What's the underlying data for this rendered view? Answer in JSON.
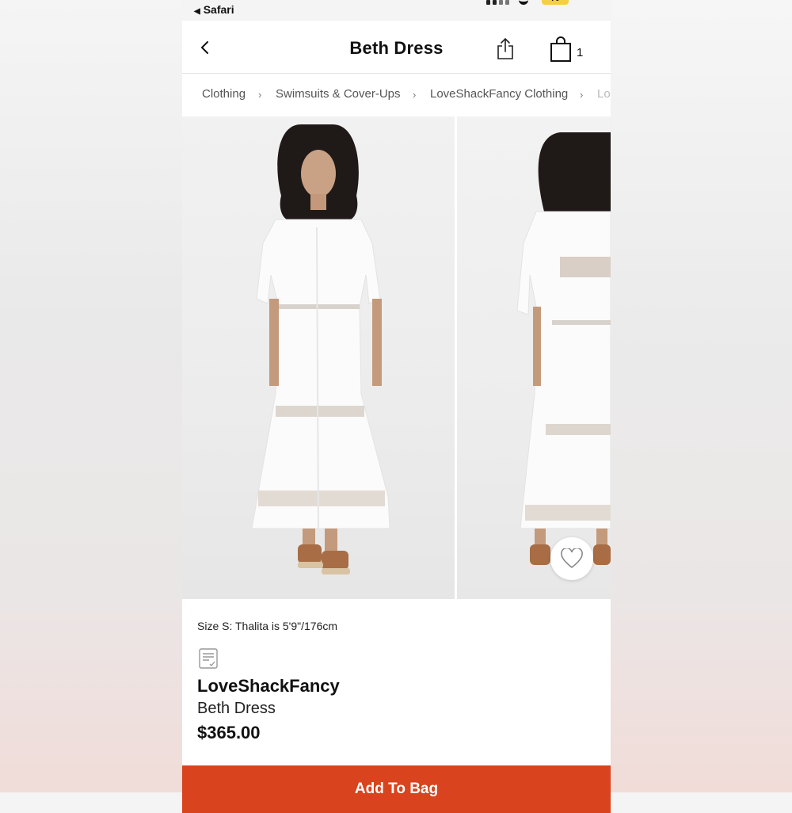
{
  "status_bar": {
    "back_app": "Safari",
    "battery": "70"
  },
  "header": {
    "title": "Beth Dress",
    "bag_count": "1"
  },
  "breadcrumbs": [
    "Clothing",
    "Swimsuits & Cover-Ups",
    "LoveShackFancy Clothing",
    "Lo"
  ],
  "product": {
    "size_note": "Size S: Thalita is 5'9\"/176cm",
    "brand": "LoveShackFancy",
    "name": "Beth Dress",
    "price": "$365.00"
  },
  "actions": {
    "add_to_bag": "Add To Bag"
  },
  "icons": [
    "back-chevron-icon",
    "share-icon",
    "shopping-bag-icon",
    "heart-icon",
    "notes-icon"
  ],
  "colors": {
    "cta": "#d9431e",
    "text": "#111111",
    "crumb": "#555555"
  }
}
